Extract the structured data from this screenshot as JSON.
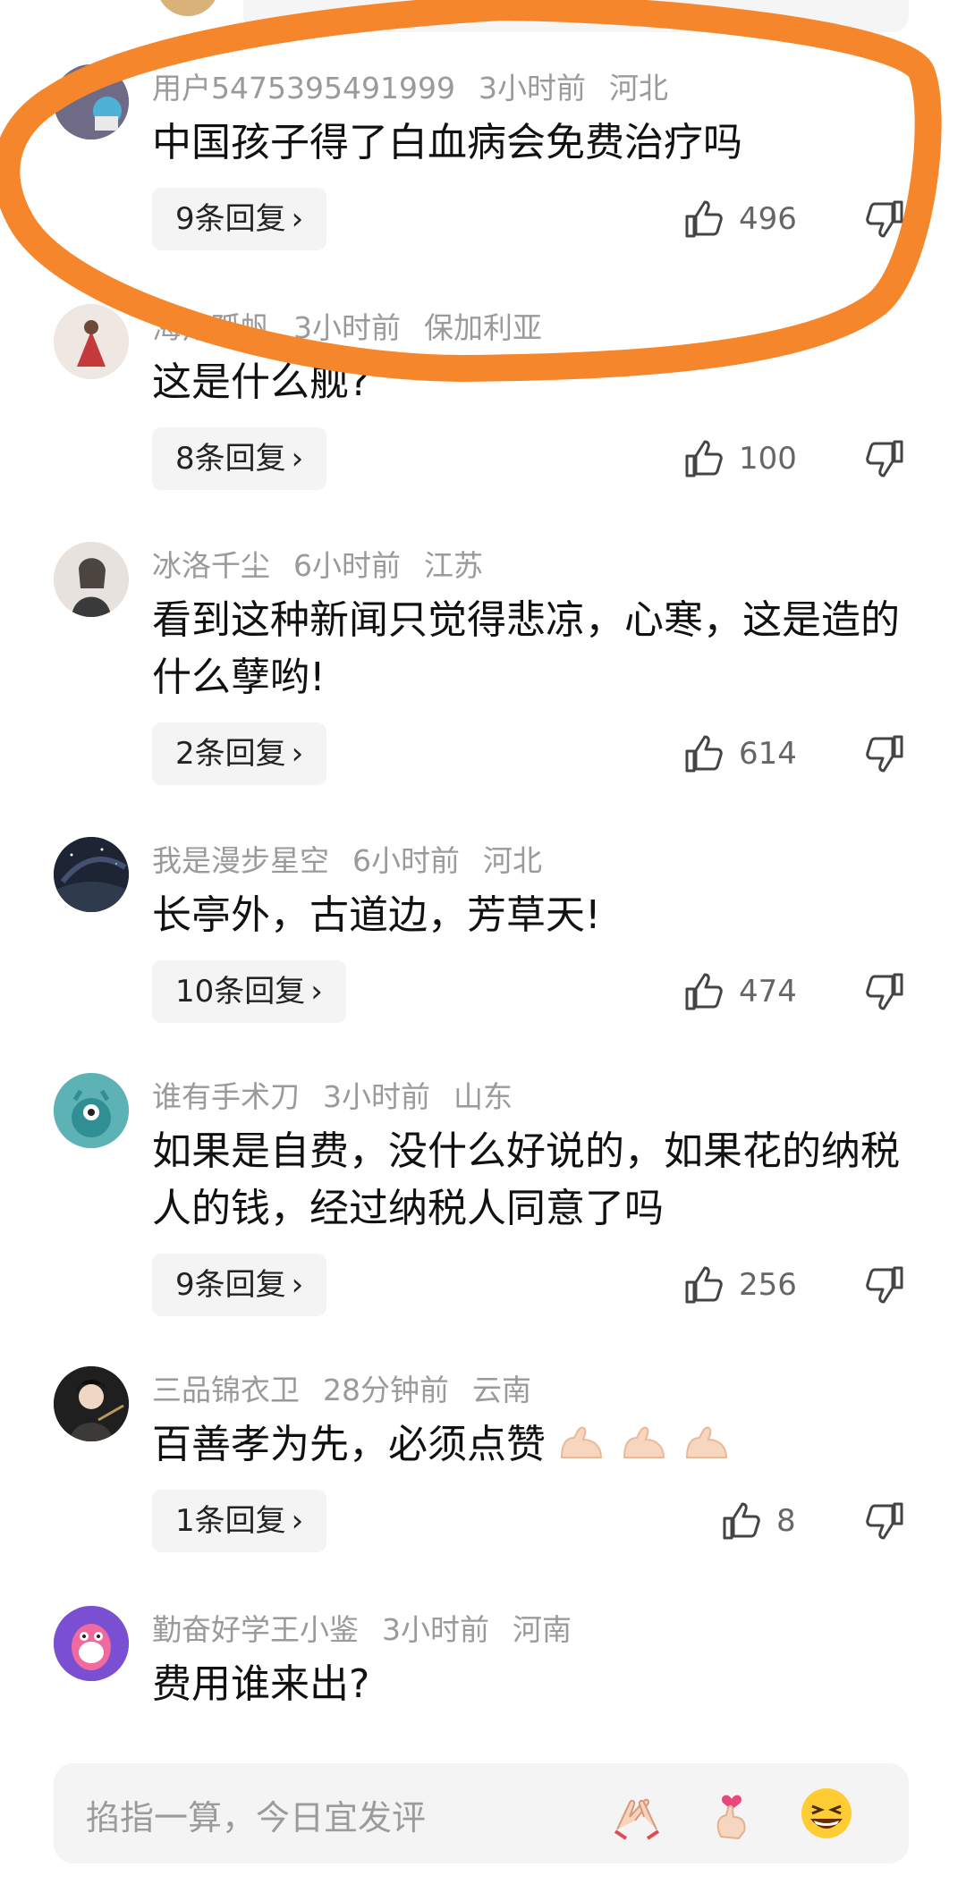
{
  "comments": [
    {
      "user": "用户5475395491999",
      "time": "3小时前",
      "location": "河北",
      "text": "中国孩子得了白血病会免费治疗吗",
      "replies": "9条回复",
      "likes": "496"
    },
    {
      "user": "海角孤帆",
      "time": "3小时前",
      "location": "保加利亚",
      "text": "这是什么舰?",
      "replies": "8条回复",
      "likes": "100"
    },
    {
      "user": "冰洛千尘",
      "time": "6小时前",
      "location": "江苏",
      "text": "看到这种新闻只觉得悲凉，心寒，这是造的什么孽哟!",
      "replies": "2条回复",
      "likes": "614"
    },
    {
      "user": "我是漫步星空",
      "time": "6小时前",
      "location": "河北",
      "text": "长亭外，古道边，芳草天!",
      "replies": "10条回复",
      "likes": "474"
    },
    {
      "user": "谁有手术刀",
      "time": "3小时前",
      "location": "山东",
      "text": "如果是自费，没什么好说的，如果花的纳税人的钱，经过纳税人同意了吗",
      "replies": "9条回复",
      "likes": "256"
    },
    {
      "user": "三品锦衣卫",
      "time": "28分钟前",
      "location": "云南",
      "text": "百善孝为先，必须点赞",
      "replies": "1条回复",
      "likes": "8"
    },
    {
      "user": "勤奋好学王小鉴",
      "time": "3小时前",
      "location": "河南",
      "text": "费用谁来出?"
    }
  ],
  "input": {
    "placeholder": "掐指一算，今日宜发评"
  },
  "icons": {
    "like": "thumb-up-icon",
    "dislike": "thumb-down-icon",
    "chevron": "chevron-right-icon"
  },
  "colors": {
    "highlight": "#f5862c",
    "meta": "#9a9a9a",
    "reply_bg": "#f4f4f4"
  }
}
